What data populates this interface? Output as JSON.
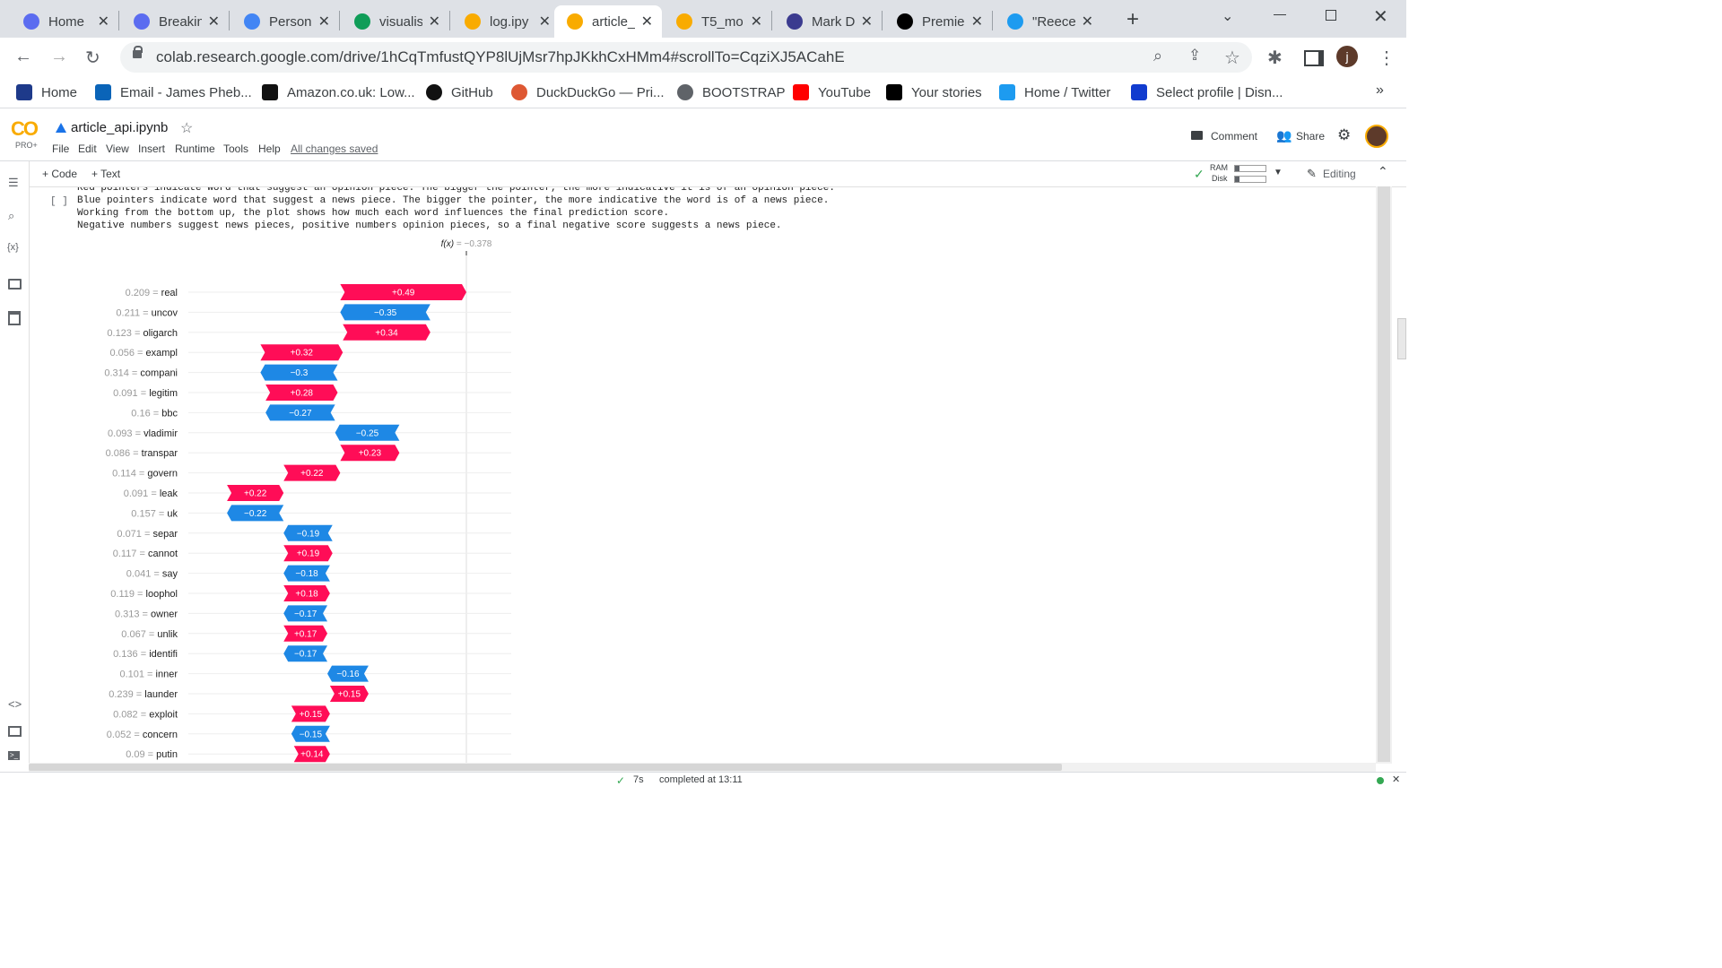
{
  "browser": {
    "tabs": [
      {
        "label": "Home",
        "icon": "copilot-c-icon",
        "color": "#5b6cf0"
      },
      {
        "label": "Breakin",
        "icon": "copilot-c-icon",
        "color": "#5b6cf0"
      },
      {
        "label": "Person",
        "icon": "google-g-icon",
        "color": "#4285f4"
      },
      {
        "label": "visualis",
        "icon": "google-drive-icon",
        "color": "#0f9d58"
      },
      {
        "label": "log.ipy",
        "icon": "colab-icon",
        "color": "#f9ab00"
      },
      {
        "label": "article_",
        "icon": "colab-icon",
        "color": "#f9ab00",
        "active": true
      },
      {
        "label": "T5_mo",
        "icon": "colab-icon",
        "color": "#f9ab00"
      },
      {
        "label": "Mark D",
        "icon": "site-icon",
        "color": "#3b3b8f"
      },
      {
        "label": "Premie",
        "icon": "medium-icon",
        "color": "#000000"
      },
      {
        "label": "\"Reece",
        "icon": "twitter-icon",
        "color": "#1d9bf0"
      }
    ],
    "new_tab_label": "+",
    "url": "colab.research.google.com/drive/1hCqTmfustQYP8lUjMsr7hpJKkhCxHMm4#scrollTo=CqziXJ5ACahE",
    "profile_initial": "j",
    "bookmarks": [
      {
        "label": "Home",
        "icon": "home-bookmark-icon"
      },
      {
        "label": "Email - James Pheb...",
        "icon": "outlook-icon"
      },
      {
        "label": "Amazon.co.uk: Low...",
        "icon": "amazon-icon"
      },
      {
        "label": "GitHub",
        "icon": "github-icon"
      },
      {
        "label": "DuckDuckGo — Pri...",
        "icon": "duckduckgo-icon"
      },
      {
        "label": "BOOTSTRAP",
        "icon": "globe-icon"
      },
      {
        "label": "YouTube",
        "icon": "youtube-icon"
      },
      {
        "label": "Your stories",
        "icon": "medium-icon"
      },
      {
        "label": "Home / Twitter",
        "icon": "twitter-icon"
      },
      {
        "label": "Select profile | Disn...",
        "icon": "disney-icon"
      }
    ],
    "more_bookmarks": "»"
  },
  "colab": {
    "logo_text": "CO",
    "pro_badge": "PRO+",
    "notebook_name": "article_api.ipynb",
    "menus": [
      "File",
      "Edit",
      "View",
      "Insert",
      "Runtime",
      "Tools",
      "Help"
    ],
    "save_status": "All changes saved",
    "comment_label": "Comment",
    "share_label": "Share",
    "add_code_label": "+ Code",
    "add_text_label": "+ Text",
    "ram_label": "RAM",
    "disk_label": "Disk",
    "editing_label": "Editing",
    "cell_run_indicator": "[ ]",
    "output_lines": [
      "Red pointers indicate word that suggest an opinion piece. The bigger the pointer, the more indicative it is of an opinion piece.",
      "Blue pointers indicate word that suggest a news piece. The bigger the pointer, the more indicative the word is of a news piece.",
      "Working from the bottom up, the plot shows how much each word influences the final prediction score.",
      "Negative numbers suggest news pieces, positive numbers opinion pieces, so a final negative score suggests a news piece."
    ],
    "status_time": "7s",
    "status_text": "completed at 13:11"
  },
  "chart_data": {
    "type": "waterfall",
    "fx_label": "f(x)",
    "fx_value": "−0.378",
    "final_value": -0.378,
    "positive_color": "#ff0d57",
    "negative_color": "#1e88e5",
    "rows": [
      {
        "feature": "real",
        "feature_value": "0.209",
        "contribution": 0.49,
        "label": "+0.49"
      },
      {
        "feature": "uncov",
        "feature_value": "0.211",
        "contribution": -0.35,
        "label": "−0.35"
      },
      {
        "feature": "oligarch",
        "feature_value": "0.123",
        "contribution": 0.34,
        "label": "+0.34"
      },
      {
        "feature": "exampl",
        "feature_value": "0.056",
        "contribution": 0.32,
        "label": "+0.32"
      },
      {
        "feature": "compani",
        "feature_value": "0.314",
        "contribution": -0.3,
        "label": "−0.3"
      },
      {
        "feature": "legitim",
        "feature_value": "0.091",
        "contribution": 0.28,
        "label": "+0.28"
      },
      {
        "feature": "bbc",
        "feature_value": "0.16",
        "contribution": -0.27,
        "label": "−0.27"
      },
      {
        "feature": "vladimir",
        "feature_value": "0.093",
        "contribution": -0.25,
        "label": "−0.25"
      },
      {
        "feature": "transpar",
        "feature_value": "0.086",
        "contribution": 0.23,
        "label": "+0.23"
      },
      {
        "feature": "govern",
        "feature_value": "0.114",
        "contribution": 0.22,
        "label": "+0.22"
      },
      {
        "feature": "leak",
        "feature_value": "0.091",
        "contribution": 0.22,
        "label": "+0.22"
      },
      {
        "feature": "uk",
        "feature_value": "0.157",
        "contribution": -0.22,
        "label": "−0.22"
      },
      {
        "feature": "separ",
        "feature_value": "0.071",
        "contribution": -0.19,
        "label": "−0.19"
      },
      {
        "feature": "cannot",
        "feature_value": "0.117",
        "contribution": 0.19,
        "label": "+0.19"
      },
      {
        "feature": "say",
        "feature_value": "0.041",
        "contribution": -0.18,
        "label": "−0.18"
      },
      {
        "feature": "loophol",
        "feature_value": "0.119",
        "contribution": 0.18,
        "label": "+0.18"
      },
      {
        "feature": "owner",
        "feature_value": "0.313",
        "contribution": -0.17,
        "label": "−0.17"
      },
      {
        "feature": "unlik",
        "feature_value": "0.067",
        "contribution": 0.17,
        "label": "+0.17"
      },
      {
        "feature": "identifi",
        "feature_value": "0.136",
        "contribution": -0.17,
        "label": "−0.17"
      },
      {
        "feature": "inner",
        "feature_value": "0.101",
        "contribution": -0.16,
        "label": "−0.16"
      },
      {
        "feature": "launder",
        "feature_value": "0.239",
        "contribution": 0.15,
        "label": "+0.15"
      },
      {
        "feature": "exploit",
        "feature_value": "0.082",
        "contribution": 0.15,
        "label": "+0.15"
      },
      {
        "feature": "concern",
        "feature_value": "0.052",
        "contribution": -0.15,
        "label": "−0.15"
      },
      {
        "feature": "putin",
        "feature_value": "0.09",
        "contribution": 0.14,
        "label": "+0.14"
      }
    ]
  }
}
